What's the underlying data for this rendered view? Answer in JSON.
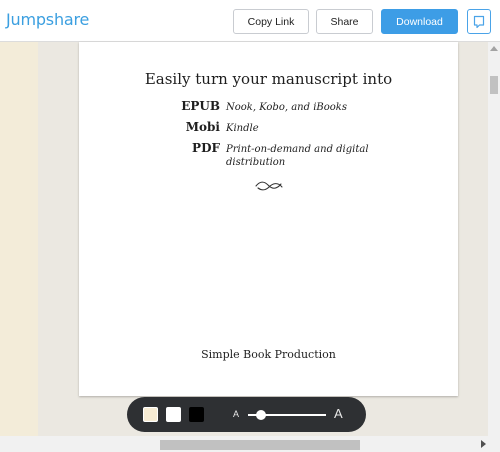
{
  "header": {
    "logo_text": "Jumpshare",
    "copy_link_label": "Copy Link",
    "share_label": "Share",
    "download_label": "Download",
    "accent_color": "#3d9de6"
  },
  "document": {
    "title": "Easily turn your manuscript into",
    "formats": [
      {
        "name": "EPUB",
        "description": "Nook, Kobo, and iBooks"
      },
      {
        "name": "Mobi",
        "description": "Kindle"
      },
      {
        "name": "PDF",
        "description": "Print-on-demand and digital distribution"
      }
    ],
    "footer": "Simple Book Production"
  },
  "reader_toolbar": {
    "themes": [
      "sepia",
      "white",
      "black"
    ],
    "font_small_label": "A",
    "font_large_label": "A",
    "font_size_level": 0.12
  }
}
